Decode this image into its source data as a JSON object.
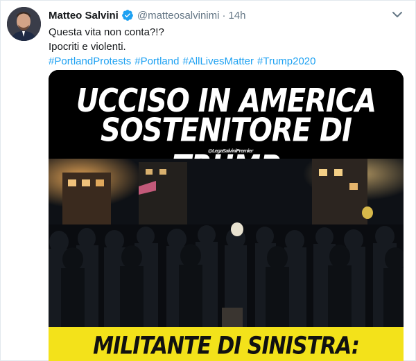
{
  "tweet": {
    "author_name": "Matteo Salvini",
    "handle": "@matteosalvinimi",
    "separator": "·",
    "time": "14h",
    "text_line1": "Questa vita non conta?!?",
    "text_line2": "Ipocriti e violenti.",
    "hashtags": [
      "#PortlandProtests",
      "#Portland",
      "#AllLivesMatter",
      "#Trump2020"
    ]
  },
  "media": {
    "headline_line1": "UCCISO IN AMERICA",
    "headline_line2": "SOSTENITORE DI TRUMP",
    "watermark": "@LegaSalviniPremier",
    "banner": "MILITANTE DI SINISTRA:"
  },
  "colors": {
    "link": "#1da1f2",
    "verified": "#1da1f2",
    "banner": "#f3e21a"
  },
  "icons": {
    "verified": "verified-badge-icon",
    "caret": "chevron-down-icon"
  }
}
